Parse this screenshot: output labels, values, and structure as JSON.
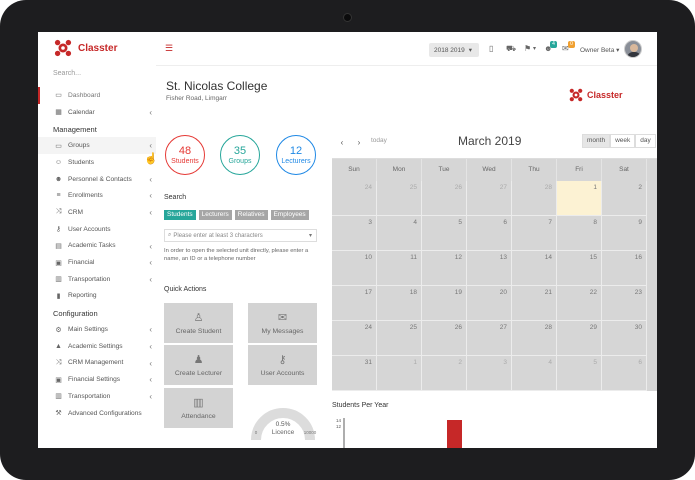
{
  "brand": {
    "name": "Classter",
    "accent": "#c62828"
  },
  "sidebar": {
    "search_placeholder": "Search...",
    "top_items": [
      {
        "label": "Dashboard",
        "icon": "laptop-icon",
        "chevron": false
      },
      {
        "label": "Calendar",
        "icon": "calendar-icon",
        "chevron": true
      }
    ],
    "management_title": "Management",
    "management_items": [
      {
        "label": "Groups",
        "icon": "folder-icon",
        "chevron": true
      },
      {
        "label": "Students",
        "icon": "user-icon",
        "chevron": false
      },
      {
        "label": "Personnel & Contacts",
        "icon": "users-icon",
        "chevron": true
      },
      {
        "label": "Enrollments",
        "icon": "list-icon",
        "chevron": true
      },
      {
        "label": "CRM",
        "icon": "shuffle-icon",
        "chevron": true
      },
      {
        "label": "User Accounts",
        "icon": "key-icon",
        "chevron": false
      },
      {
        "label": "Academic Tasks",
        "icon": "book-icon",
        "chevron": true
      },
      {
        "label": "Financial",
        "icon": "money-icon",
        "chevron": true
      },
      {
        "label": "Transportation",
        "icon": "bus-icon",
        "chevron": true
      },
      {
        "label": "Reporting",
        "icon": "chart-icon",
        "chevron": false
      }
    ],
    "configuration_title": "Configuration",
    "configuration_items": [
      {
        "label": "Main Settings",
        "icon": "settings-icon",
        "chevron": true
      },
      {
        "label": "Academic Settings",
        "icon": "graduation-icon",
        "chevron": true
      },
      {
        "label": "CRM Management",
        "icon": "shuffle-icon",
        "chevron": true
      },
      {
        "label": "Financial Settings",
        "icon": "money-icon",
        "chevron": true
      },
      {
        "label": "Transportation",
        "icon": "bus-icon",
        "chevron": true
      },
      {
        "label": "Advanced Configurations",
        "icon": "wrench-icon",
        "chevron": false
      }
    ]
  },
  "topbar": {
    "year": "2018 2019",
    "notification_count": "4",
    "message_count": "0",
    "user_name": "Owner Beta"
  },
  "page": {
    "title": "St. Nicolas College",
    "subtitle": "Fisher Road, Limgarr"
  },
  "stats": [
    {
      "value": "48",
      "label": "Students",
      "color": "#e53935"
    },
    {
      "value": "35",
      "label": "Groups",
      "color": "#26a69a"
    },
    {
      "value": "12",
      "label": "Lecturers",
      "color": "#1e88e5"
    }
  ],
  "search": {
    "title": "Search",
    "chips": [
      "Students",
      "Lecturers",
      "Relatives",
      "Employees"
    ],
    "placeholder": "Please enter at least 3 characters",
    "help": "In order to open the selected unit directly, please enter a name, an ID or a telephone number"
  },
  "quick_actions": {
    "title": "Quick Actions",
    "items": [
      {
        "label": "Create Student",
        "icon": "user-icon"
      },
      {
        "label": "My Messages",
        "icon": "envelope-icon"
      },
      {
        "label": "Create Lecturer",
        "icon": "person-icon"
      },
      {
        "label": "User Accounts",
        "icon": "key-icon"
      },
      {
        "label": "Attendance",
        "icon": "bar-chart-icon"
      }
    ],
    "licence": {
      "label": "Licence",
      "value": "0.5%",
      "min": "0",
      "max": "10000"
    }
  },
  "calendar": {
    "today_label": "today",
    "title": "March 2019",
    "views": [
      "month",
      "week",
      "day"
    ],
    "weekdays": [
      "Sun",
      "Mon",
      "Tue",
      "Wed",
      "Thu",
      "Fri",
      "Sat"
    ],
    "days": [
      "24",
      "25",
      "26",
      "27",
      "28",
      "1",
      "2",
      "3",
      "4",
      "5",
      "6",
      "7",
      "8",
      "9",
      "10",
      "11",
      "12",
      "13",
      "14",
      "15",
      "16",
      "17",
      "18",
      "19",
      "20",
      "21",
      "22",
      "23",
      "24",
      "25",
      "26",
      "27",
      "28",
      "29",
      "30",
      "31",
      "1",
      "2",
      "3",
      "4",
      "5",
      "6"
    ]
  },
  "students_per_year": {
    "title": "Students Per Year",
    "chart_data": {
      "type": "bar",
      "categories": [
        ""
      ],
      "values": [
        14
      ],
      "y_ticks": [
        "14",
        "12"
      ],
      "color": "#c62828"
    }
  }
}
